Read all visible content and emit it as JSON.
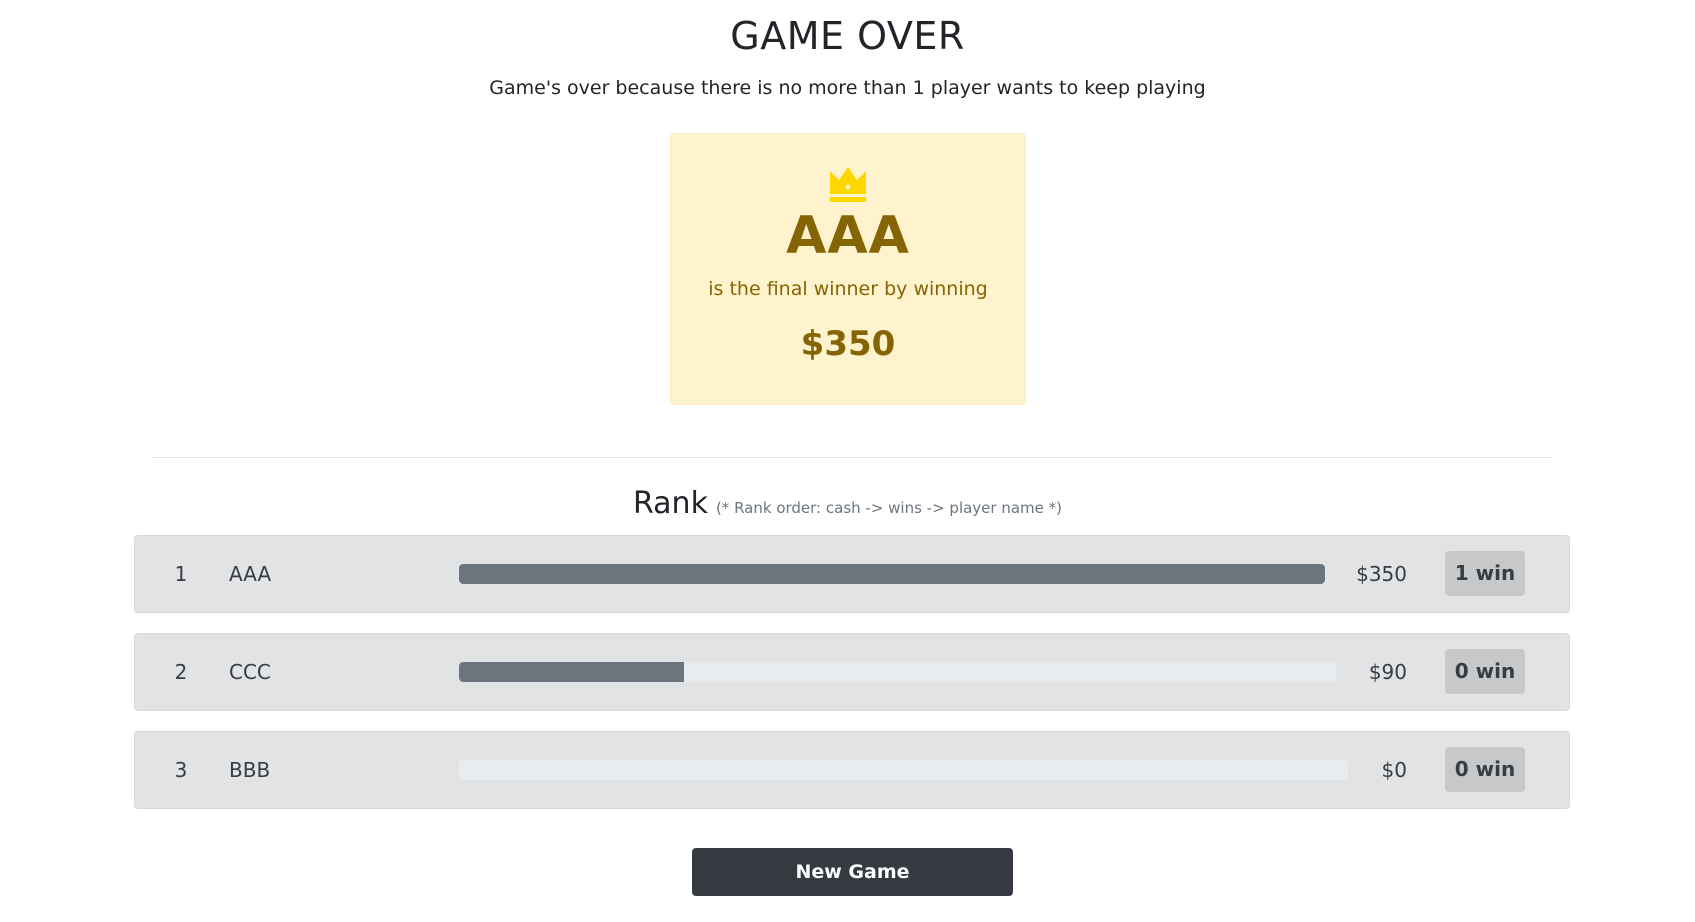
{
  "header": {
    "title": "GAME OVER",
    "subtitle": "Game's over because there is no more than 1 player wants to keep playing"
  },
  "winner": {
    "icon": "crown-icon",
    "name": "AAA",
    "text": "is the final winner by winning",
    "amount": "$350"
  },
  "rank": {
    "title": "Rank",
    "note": "(* Rank order: cash -> wins -> player name *)",
    "rows": [
      {
        "position": "1",
        "name": "AAA",
        "cash": "$350",
        "wins": "1 win",
        "progress": 1.0
      },
      {
        "position": "2",
        "name": "CCC",
        "cash": "$90",
        "wins": "0 win",
        "progress": 0.2571
      },
      {
        "position": "3",
        "name": "BBB",
        "cash": "$0",
        "wins": "0 win",
        "progress": 0.0
      }
    ]
  },
  "actions": {
    "new_game_label": "New Game"
  },
  "colors": {
    "winner_background": "#fff3cd",
    "winner_text": "#856404",
    "crown": "#ffd700",
    "row_background": "#e2e3e5",
    "bar_fill": "#6c757d",
    "bar_track": "#e9ecef",
    "badge_background": "#c6c8ca",
    "button_background": "#343a40"
  }
}
